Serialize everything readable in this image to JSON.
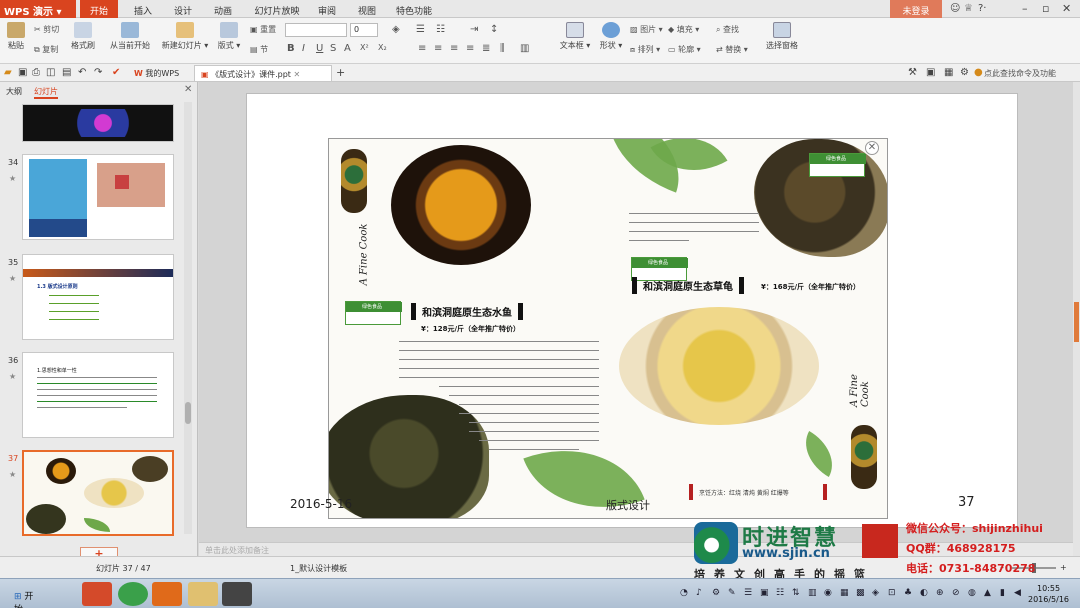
{
  "app": {
    "menu_button": "WPS 演示",
    "tabs": [
      "开始",
      "插入",
      "设计",
      "动画",
      "幻灯片放映",
      "审阅",
      "视图",
      "特色功能"
    ],
    "active_tab": "开始",
    "login": "未登录"
  },
  "ribbon": {
    "paste": "粘贴",
    "cut": "剪切",
    "copy": "复制",
    "format_painter": "格式刷",
    "from_current": "从当前开始",
    "new_slide": "新建幻灯片",
    "layout": "版式",
    "reset": "重置",
    "section": "节",
    "font_size": "0",
    "text_box": "文本框",
    "shapes": "形状",
    "picture": "图片",
    "fill": "填充",
    "arrange": "排列",
    "outline": "轮廓",
    "find": "查找",
    "replace": "替换",
    "select_pane": "选择窗格"
  },
  "quick_access": {
    "doc_tabs": [
      "我的WPS",
      "《版式设计》课件.ppt"
    ],
    "help": "点此查找命令及功能"
  },
  "left_panel": {
    "tabs": [
      "大纲",
      "幻灯片"
    ],
    "active_tab": "幻灯片",
    "thumb_numbers": [
      "34",
      "35",
      "36",
      "37"
    ],
    "thumb35_title": "1.3 版式设计原则",
    "thumb36_title": "1.思想性和单一性"
  },
  "slide": {
    "heading1": "和滨洞庭原生态水鱼",
    "price1": "¥：128元/斤（全年推广特价）",
    "heading2": "和滨洞庭原生态草龟",
    "price2": "¥：168元/斤（全年推广特价）",
    "badge": "绿色食品",
    "tags": "烹饪方法：红烧  清炖  黄焖  红爆等",
    "script": "A Fine Cook",
    "footer_date": "2016-5-16",
    "footer_title": "版式设计",
    "footer_num": "37"
  },
  "notes": {
    "placeholder": "单击此处添加备注"
  },
  "status": {
    "slide_count": "幻灯片 37 / 47",
    "template": "1_默认设计模板"
  },
  "watermark": {
    "brand": "时进智慧",
    "url": "www.sjin.cn",
    "wechat": "微信公众号：shijinzhihui",
    "qq": "QQ群：468928175",
    "phone": "电话：0731-84870278",
    "slogan": "培养文创高手的摇篮"
  },
  "taskbar": {
    "start": "开始",
    "time": "10:55",
    "date": "2016/5/16"
  }
}
